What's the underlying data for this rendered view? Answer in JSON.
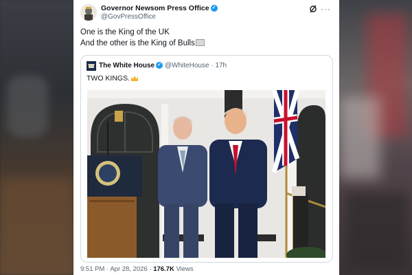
{
  "post": {
    "author_name": "Governor Newsom Press Office",
    "author_handle": "@GovPressOffice",
    "text_line1": "One is the King of the UK",
    "text_line2": "And the other is the King of Bulls"
  },
  "quoted_post": {
    "author_name": "The White House",
    "author_handle": "@WhiteHouse",
    "separator": "·",
    "time_ago": "17h",
    "text": "TWO KINGS."
  },
  "footer": {
    "time": "9:51 PM",
    "separator": "·",
    "date": "Apr 28, 2026",
    "separator2": "·",
    "views_count": "176.7K",
    "views_label": "Views"
  },
  "colors": {
    "verified_badge": "#1d9bf0",
    "text_primary": "#0f1419",
    "text_secondary": "#536471",
    "border": "#cfd9de"
  },
  "icons": {
    "verified": "verified-check-icon",
    "grok": "grok-icon",
    "more": "more-dots-icon",
    "flag": "flag-emoji-icon",
    "crown": "crown-emoji-icon"
  }
}
